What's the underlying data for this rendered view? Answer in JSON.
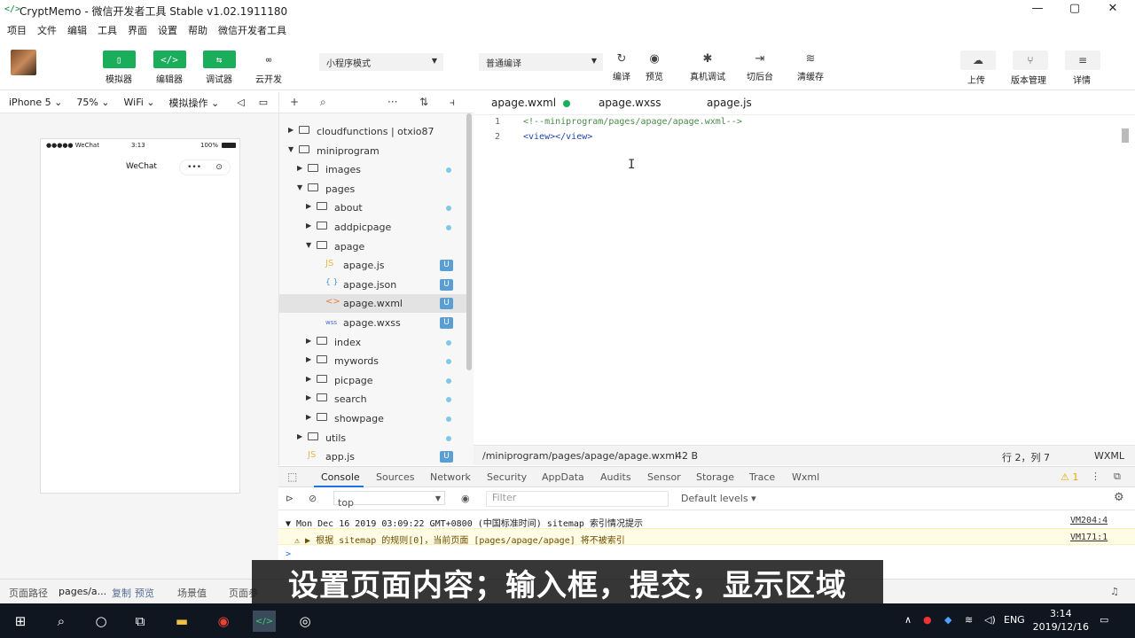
{
  "window": {
    "title": "CryptMemo - 微信开发者工具 Stable v1.02.1911180",
    "icon": "</>",
    "controls": [
      "—",
      "▢",
      "✕"
    ]
  },
  "menu": [
    "项目",
    "文件",
    "编辑",
    "工具",
    "界面",
    "设置",
    "帮助",
    "微信开发者工具"
  ],
  "toolbar": {
    "left_buttons": [
      {
        "label": "模拟器",
        "icon": "▯"
      },
      {
        "label": "编辑器",
        "icon": "</>"
      },
      {
        "label": "调试器",
        "icon": "⇆"
      },
      {
        "label": "云开发",
        "icon": "∞"
      }
    ],
    "mode_select": "小程序模式",
    "compile_select": "普通编译",
    "middle_tools": [
      {
        "label": "编译",
        "icon": "↻"
      },
      {
        "label": "预览",
        "icon": "◉"
      },
      {
        "label": "真机调试",
        "icon": "✱"
      },
      {
        "label": "切后台",
        "icon": "⇥"
      },
      {
        "label": "清缓存",
        "icon": "≋"
      }
    ],
    "right_tools": [
      {
        "label": "上传",
        "icon": "☁"
      },
      {
        "label": "版本管理",
        "icon": "⑂"
      },
      {
        "label": "详情",
        "icon": "≡"
      }
    ]
  },
  "simulator": {
    "device": "iPhone 5",
    "zoom": "75%",
    "network": "WiFi",
    "operation": "模拟操作",
    "phone": {
      "carrier": "●●●●● WeChat",
      "time": "3:13",
      "battery": "100%",
      "nav_title": "WeChat",
      "capsule_dots": "•••",
      "capsule_close": "⊙"
    }
  },
  "tree": {
    "header_icons": [
      "+",
      "⌕",
      "···",
      "⇅",
      "⫞"
    ],
    "items": [
      {
        "name": "cloudfunctions | otxio87",
        "kind": "folder",
        "depth": 0,
        "arrow": "▶",
        "mark": ""
      },
      {
        "name": "miniprogram",
        "kind": "folder-open",
        "depth": 0,
        "arrow": "▼",
        "mark": ""
      },
      {
        "name": "images",
        "kind": "folder",
        "depth": 1,
        "arrow": "▶",
        "mark": "dot"
      },
      {
        "name": "pages",
        "kind": "folder-open",
        "depth": 1,
        "arrow": "▼",
        "mark": ""
      },
      {
        "name": "about",
        "kind": "folder",
        "depth": 2,
        "arrow": "▶",
        "mark": "dot"
      },
      {
        "name": "addpicpage",
        "kind": "folder",
        "depth": 2,
        "arrow": "▶",
        "mark": "dot"
      },
      {
        "name": "apage",
        "kind": "folder-open",
        "depth": 2,
        "arrow": "▼",
        "mark": ""
      },
      {
        "name": "apage.js",
        "kind": "js",
        "depth": 3,
        "arrow": "",
        "mark": "U"
      },
      {
        "name": "apage.json",
        "kind": "json",
        "depth": 3,
        "arrow": "",
        "mark": "U"
      },
      {
        "name": "apage.wxml",
        "kind": "wxml",
        "depth": 3,
        "arrow": "",
        "mark": "U",
        "selected": true
      },
      {
        "name": "apage.wxss",
        "kind": "wxss",
        "depth": 3,
        "arrow": "",
        "mark": "U"
      },
      {
        "name": "index",
        "kind": "folder",
        "depth": 2,
        "arrow": "▶",
        "mark": "dot"
      },
      {
        "name": "mywords",
        "kind": "folder",
        "depth": 2,
        "arrow": "▶",
        "mark": "dot"
      },
      {
        "name": "picpage",
        "kind": "folder",
        "depth": 2,
        "arrow": "▶",
        "mark": "dot"
      },
      {
        "name": "search",
        "kind": "folder",
        "depth": 2,
        "arrow": "▶",
        "mark": "dot"
      },
      {
        "name": "showpage",
        "kind": "folder",
        "depth": 2,
        "arrow": "▶",
        "mark": "dot"
      },
      {
        "name": "utils",
        "kind": "folder",
        "depth": 1,
        "arrow": "▶",
        "mark": "dot"
      },
      {
        "name": "app.js",
        "kind": "js",
        "depth": 1,
        "arrow": "",
        "mark": "U"
      }
    ]
  },
  "editor": {
    "tabs": [
      "apage.wxml",
      "apage.wxss",
      "apage.js"
    ],
    "active_tab": "apage.wxml",
    "lines": [
      {
        "n": "1",
        "text": "<!--miniprogram/pages/apage/apage.wxml-->"
      },
      {
        "n": "2",
        "text": "<view></view>"
      }
    ],
    "status": {
      "path": "/miniprogram/pages/apage/apage.wxml",
      "size": "42 B",
      "cursor": "行 2，列 7",
      "lang": "WXML"
    }
  },
  "devtools": {
    "tabs": [
      "Console",
      "Sources",
      "Network",
      "Security",
      "AppData",
      "Audits",
      "Sensor",
      "Storage",
      "Trace",
      "Wxml"
    ],
    "active": "Console",
    "warn_count": "1",
    "context": "top",
    "filter_placeholder": "Filter",
    "levels": "Default levels ▾",
    "messages": [
      {
        "text": "▼ Mon Dec 16 2019 03:09:22 GMT+0800 (中国标准时间) sitemap 索引情况提示",
        "source": "VM204:4",
        "level": "info"
      },
      {
        "text": "⚠ ▶ 根据 sitemap 的规则[0]，当前页面 [pages/apage/apage] 将不被索引",
        "source": "VM171:1",
        "level": "warn"
      }
    ],
    "prompt": ">"
  },
  "ide_bottom": {
    "path_label": "页面路径",
    "path_value": "pages/a...",
    "copy": "复制",
    "preview": "预览",
    "scene": "场景值",
    "params": "页面参"
  },
  "subtitle": "设置页面内容；输入框，提交，显示区域",
  "taskbar": {
    "tray_lang": "ENG",
    "time": "3:14",
    "date": "2019/12/16"
  }
}
